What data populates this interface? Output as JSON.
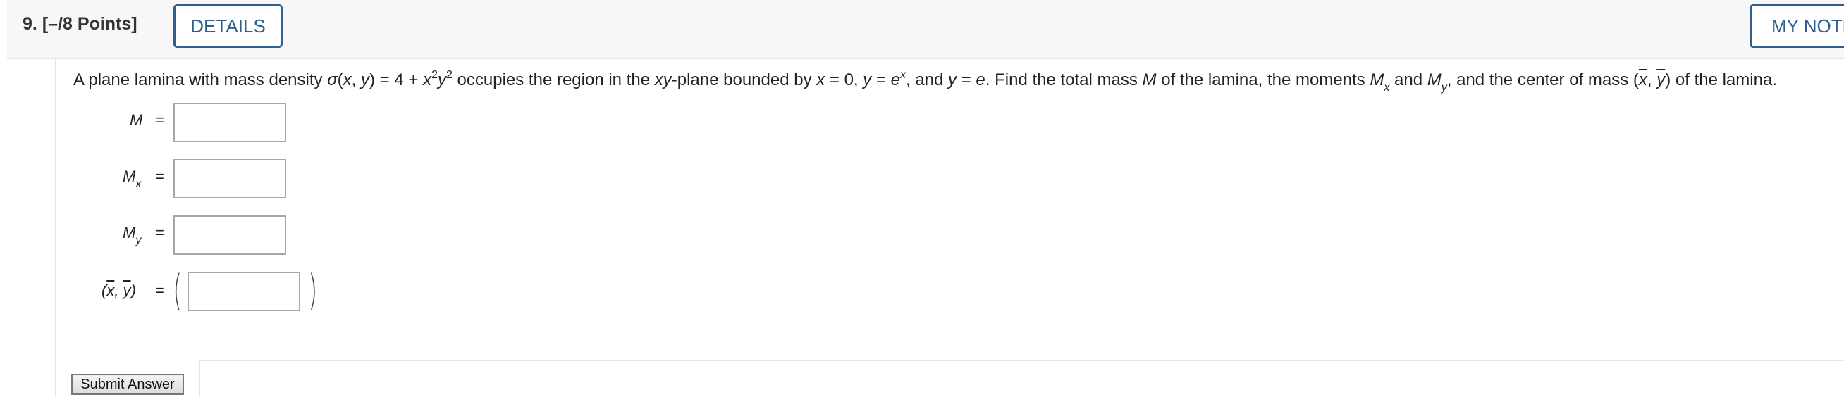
{
  "header": {
    "question_number": "9.",
    "points": "[–/8 Points]",
    "details_label": "DETAILS",
    "notes_label": "MY NOTES"
  },
  "problem": {
    "p1": "A plane lamina with mass density ",
    "sigma": "σ",
    "p2": "(",
    "x1": "x",
    "p3": ", ",
    "y1": "y",
    "p4": ") = 4 + ",
    "x2": "x",
    "exp2a": "2",
    "y2": "y",
    "exp2b": "2",
    "p5": " occupies the region in the ",
    "xy": "xy",
    "p6": "-plane bounded by ",
    "x3": "x",
    "p7": " = 0, ",
    "y3": "y",
    "p8": " = ",
    "e1": "e",
    "expx": "x",
    "p9": ", and ",
    "y4": "y",
    "p10": " = ",
    "e2": "e",
    "p11": ". Find the total mass ",
    "M": "M",
    "p12": " of the lamina, the moments ",
    "M2": "M",
    "subx": "x",
    "p13": " and ",
    "M3": "M",
    "suby": "y",
    "p14": ", and the center of mass (",
    "xbar": "x",
    "p15": ", ",
    "ybar": "y",
    "p16": ") of the lamina."
  },
  "answers": {
    "M_label": "M",
    "Mx_label": "M",
    "Mx_sub": "x",
    "My_label": "M",
    "My_sub": "y",
    "center_open": "(",
    "center_x": "x",
    "center_sep": ", ",
    "center_y": "y",
    "center_close": ")",
    "equals": "=",
    "M_value": "",
    "Mx_value": "",
    "My_value": "",
    "center_value": "",
    "paren_open": "(",
    "paren_close": ")"
  },
  "submit": {
    "label": "Submit Answer"
  },
  "colors": {
    "accent": "#2f5f8f",
    "header_bg": "#f7f7f7",
    "input_border": "#a6a6a6"
  }
}
